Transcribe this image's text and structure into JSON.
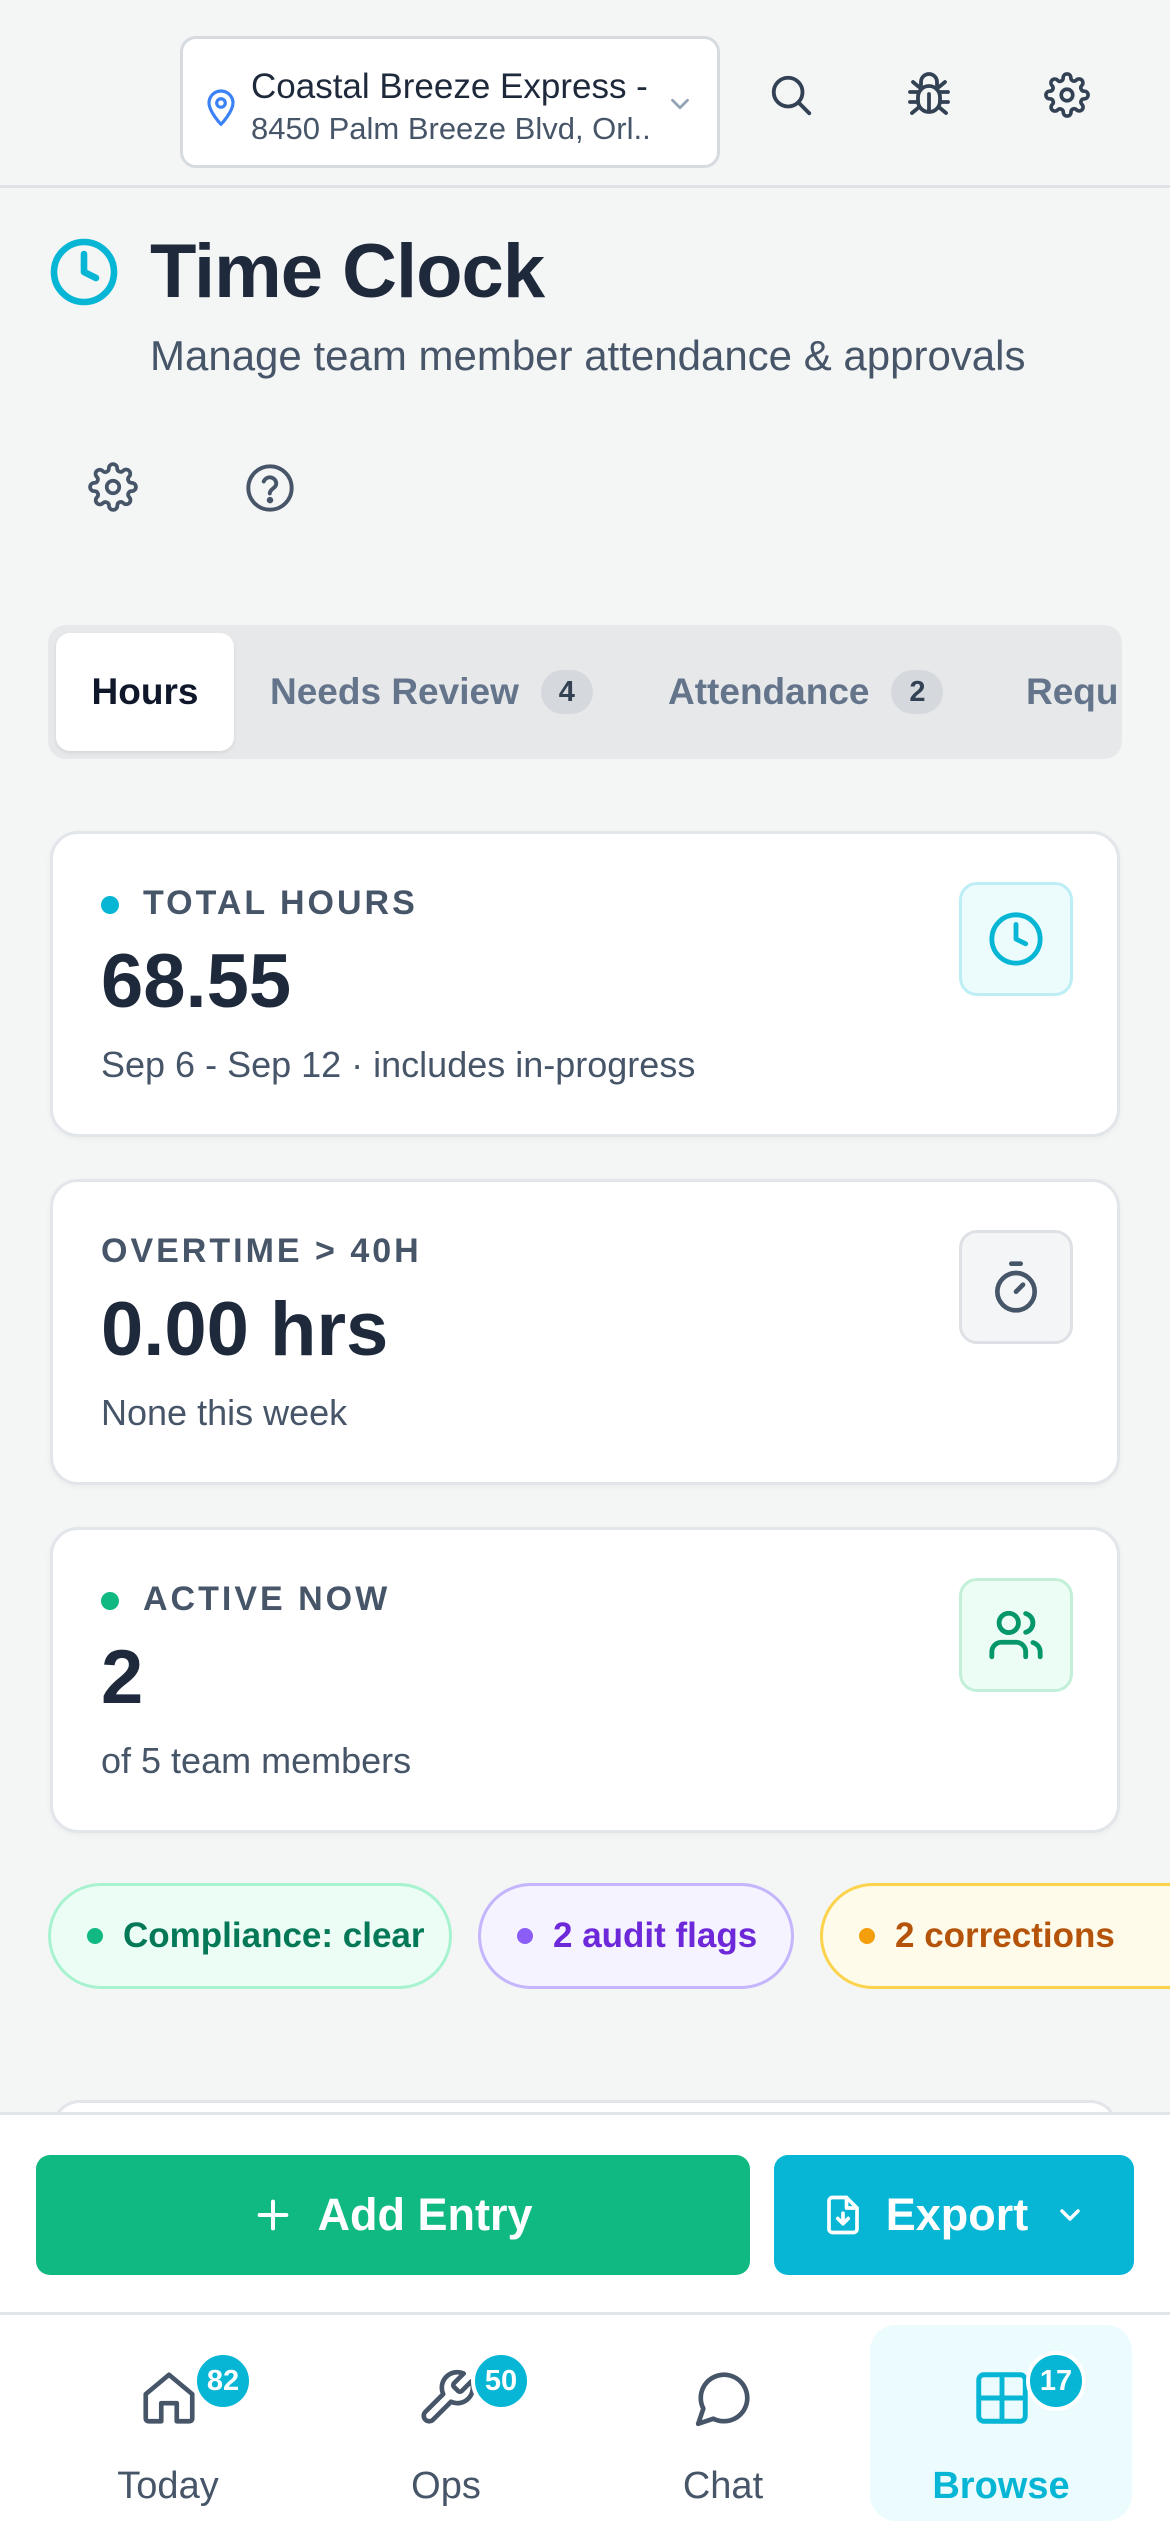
{
  "location": {
    "name": "Coastal Breeze Express -...",
    "address": "8450 Palm Breeze Blvd, Orl..."
  },
  "header_icons": [
    "search-icon",
    "bug-icon",
    "gear-icon"
  ],
  "page": {
    "title": "Time Clock",
    "subtitle": "Manage team member attendance & approvals"
  },
  "tabs": [
    {
      "label": "Hours",
      "badge": null,
      "active": true
    },
    {
      "label": "Needs Review",
      "badge": "4",
      "active": false
    },
    {
      "label": "Attendance",
      "badge": "2",
      "active": false
    },
    {
      "label": "Requ",
      "badge": null,
      "active": false
    }
  ],
  "stats": {
    "total_hours": {
      "label": "TOTAL HOURS",
      "value": "68.55",
      "sub": "Sep 6 - Sep 12 · includes in-progress",
      "dot_color": "#06b6d4",
      "icon": "clock-icon"
    },
    "overtime": {
      "label": "OVERTIME > 40H",
      "value": "0.00 hrs",
      "sub": "None this week",
      "icon": "stopwatch-icon"
    },
    "active_now": {
      "label": "ACTIVE NOW",
      "value": "2",
      "sub": "of 5 team members",
      "dot_color": "#10b981",
      "icon": "users-icon"
    }
  },
  "chips": [
    {
      "label": "Compliance: clear",
      "color": "#047857",
      "dot": "#10b981"
    },
    {
      "label": "2 audit flags",
      "color": "#6d28d9",
      "dot": "#8b5cf6"
    },
    {
      "label": "2 corrections",
      "color": "#b45309",
      "dot": "#f59e0b"
    }
  ],
  "actions": {
    "add_label": "Add Entry",
    "export_label": "Export"
  },
  "nav": [
    {
      "label": "Today",
      "badge": "82",
      "icon": "home-icon",
      "active": false
    },
    {
      "label": "Ops",
      "badge": "50",
      "icon": "wrench-icon",
      "active": false
    },
    {
      "label": "Chat",
      "badge": null,
      "icon": "chat-icon",
      "active": false
    },
    {
      "label": "Browse",
      "badge": "17",
      "icon": "grid-icon",
      "active": true
    }
  ],
  "colors": {
    "accent": "#06b6d4",
    "primary_green": "#10b981"
  }
}
